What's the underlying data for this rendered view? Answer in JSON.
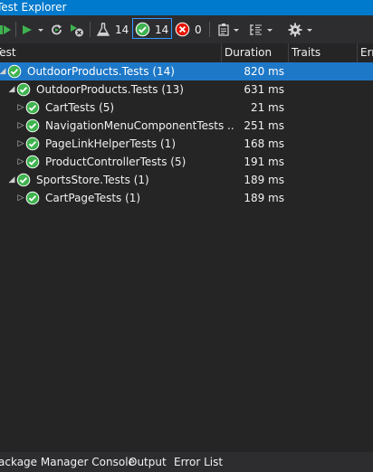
{
  "window": {
    "title": "Test Explorer"
  },
  "toolbar": {
    "flask_count": "14",
    "passed_count": "14",
    "failed_count": "0"
  },
  "columns": {
    "test": "Test",
    "duration": "Duration",
    "traits": "Traits",
    "error": "Err"
  },
  "rows": [
    {
      "name": "OutdoorProducts.Tests (14)",
      "duration": "820 ms"
    },
    {
      "name": "OutdoorProducts.Tests (13)",
      "duration": "631 ms"
    },
    {
      "name": "CartTests (5)",
      "duration": "21 ms"
    },
    {
      "name": "NavigationMenuComponentTests ..",
      "duration": "251 ms"
    },
    {
      "name": "PageLinkHelperTests (1)",
      "duration": "168 ms"
    },
    {
      "name": "ProductControllerTests (5)",
      "duration": "191 ms"
    },
    {
      "name": "SportsStore.Tests (1)",
      "duration": "189 ms"
    },
    {
      "name": "CartPageTests (1)",
      "duration": "189 ms"
    }
  ],
  "bottom_tabs": [
    "ackage Manager Console",
    "Output",
    "Error List"
  ],
  "colors": {
    "accent": "#007acc",
    "selection": "#1e78c8",
    "pass": "#3fb34f",
    "fail": "#e51400"
  },
  "icons": [
    "run-all-icon",
    "run-icon",
    "refresh-icon",
    "cancel-icon",
    "flask-icon",
    "passed-icon",
    "failed-icon",
    "playlist-icon",
    "group-by-icon",
    "settings-icon"
  ]
}
